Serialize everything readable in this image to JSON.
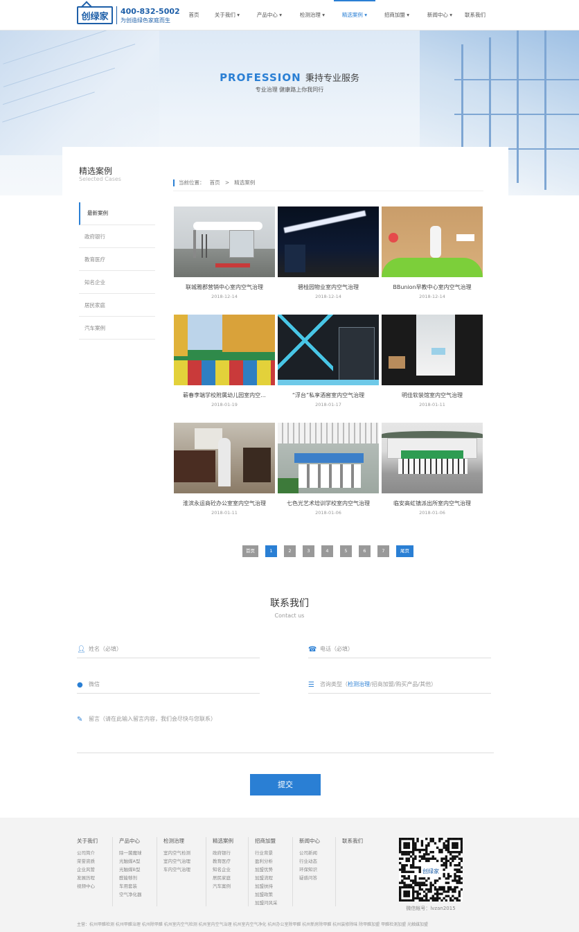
{
  "header": {
    "phone": "400-832-5002",
    "slogan": "为创造绿色家庭而生",
    "logo_text": "创绿家",
    "nav": [
      {
        "label": "首页",
        "caret": false
      },
      {
        "label": "关于我们",
        "caret": true
      },
      {
        "label": "产品中心",
        "caret": true
      },
      {
        "label": "检测治理",
        "caret": true
      },
      {
        "label": "精选案例",
        "caret": true,
        "active": true
      },
      {
        "label": "招商加盟",
        "caret": true
      },
      {
        "label": "新闻中心",
        "caret": true
      },
      {
        "label": "联系我们",
        "caret": false
      }
    ]
  },
  "banner": {
    "title_en": "PROFESSION",
    "title_cn": "秉持专业服务",
    "subtitle": "专业治理 健康路上你我同行"
  },
  "section": {
    "title": "精选案例",
    "subtitle": "Selected Cases",
    "crumb_label": "当前位置：",
    "crumb_home": "首页",
    "crumb_sep": ">",
    "crumb_current": "精选案例"
  },
  "sidebar": [
    {
      "label": "最新案例",
      "active": true
    },
    {
      "label": "政府银行"
    },
    {
      "label": "教育医疗"
    },
    {
      "label": "知名企业"
    },
    {
      "label": "居民家庭"
    },
    {
      "label": "汽车案例"
    }
  ],
  "cases": [
    {
      "title": "联城雅郡营销中心室内空气治理",
      "date": "2018-12-14",
      "img": "building"
    },
    {
      "title": "碧桂园物业室内空气治理",
      "date": "2018-12-14",
      "img": "night"
    },
    {
      "title": "BBunion早教中心室内空气治理",
      "date": "2018-12-14",
      "img": "nursery"
    },
    {
      "title": "蕲春李端学校附属幼儿园室内空...",
      "date": "2018-01-19",
      "img": "playground"
    },
    {
      "title": "“浮台”私享酒窖室内空气治理",
      "date": "2018-01-17",
      "img": "bar"
    },
    {
      "title": "明佳软装馆室内空气治理",
      "date": "2018-01-11",
      "img": "shop"
    },
    {
      "title": "淮滨永运商砼办公室室内空气治理",
      "date": "2018-01-11",
      "img": "office"
    },
    {
      "title": "七色光艺术培训学校室内空气治理",
      "date": "2018-01-06",
      "img": "team"
    },
    {
      "title": "临安高虹镇派出所室内空气治理",
      "date": "2018-01-06",
      "img": "police"
    }
  ],
  "pager": [
    "首页",
    "1",
    "2",
    "3",
    "4",
    "5",
    "6",
    "7",
    "尾页"
  ],
  "contact": {
    "title": "联系我们",
    "subtitle": "Contact us",
    "name_placeholder": "姓名（必填）",
    "phone_placeholder": "电话（必填）",
    "wechat_placeholder": "微信",
    "type_prefix": "咨询类型（",
    "type_highlight": "检测治理",
    "type_rest": "/招商加盟/购买产品/其他）",
    "message_placeholder": "留言（请在此输入留言内容，我们会尽快与您联系）",
    "submit_label": "提交"
  },
  "footer": {
    "columns": [
      {
        "title": "关于我们",
        "links": [
          "公司简介",
          "荣誉资质",
          "企业风管",
          "发展历程",
          "视频中心"
        ]
      },
      {
        "title": "产品中心",
        "links": [
          "除一菌魔球",
          "光触媒A型",
          "光触媒B型",
          "醛能够剂",
          "车用套装",
          "空气净化器"
        ]
      },
      {
        "title": "检测治理",
        "links": [
          "室内空气检测",
          "室内空气治理",
          "车内空气治理"
        ]
      },
      {
        "title": "精选案例",
        "links": [
          "政府银行",
          "教育医疗",
          "知名企业",
          "居民家庭",
          "汽车案例"
        ]
      },
      {
        "title": "招商加盟",
        "links": [
          "行业背景",
          "盈利分析",
          "加盟优势",
          "加盟流程",
          "加盟扶持",
          "加盟政策",
          "加盟问风采"
        ]
      },
      {
        "title": "新闻中心",
        "links": [
          "公司新闻",
          "行业动态",
          "环保知识",
          "疑惑问答"
        ]
      },
      {
        "title": "联系我们",
        "links": []
      }
    ],
    "qr_caption": "微信帐号：lvzan2015",
    "qr_logo": "创绿家",
    "keywords": "主营：杭州甲醛检测 杭州甲醛治理 杭州除甲醛 杭州室内空气检测 杭州室内空气治理 杭州室内空气净化 杭州办公室除甲醛 杭州新房除甲醛 杭州装修除味 除甲醛加盟 甲醛检测加盟 光触媒加盟"
  }
}
